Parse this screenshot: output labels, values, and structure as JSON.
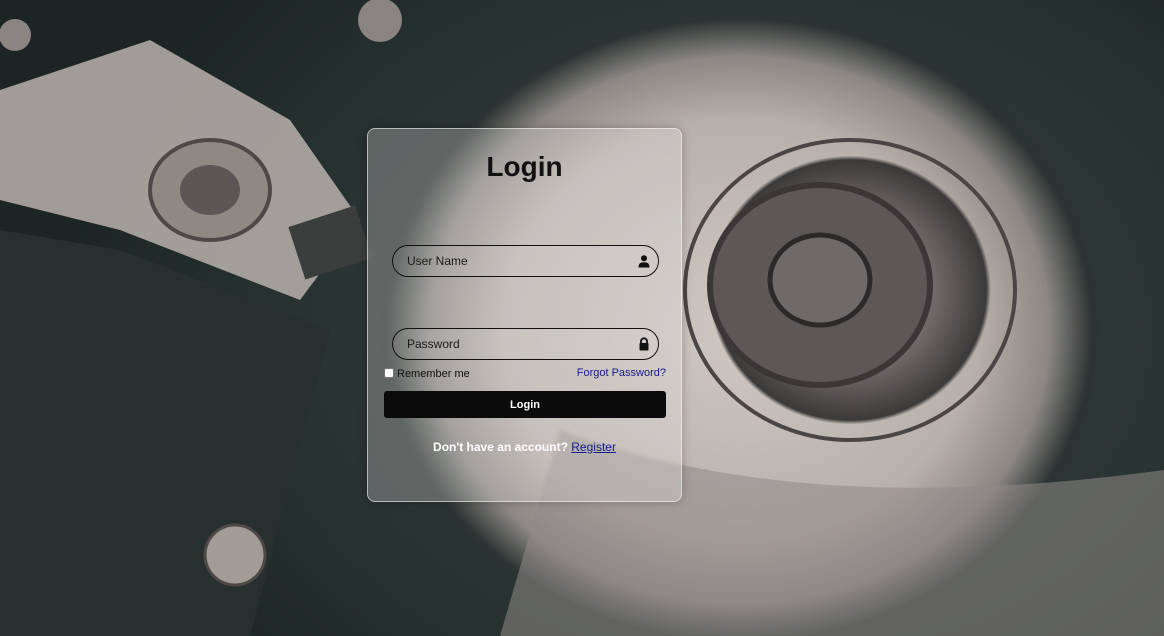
{
  "login": {
    "title": "Login",
    "username": {
      "placeholder": "User Name",
      "icon": "user-icon"
    },
    "password": {
      "placeholder": "Password",
      "icon": "lock-icon"
    },
    "remember_label": "Remember me",
    "forgot_label": "Forgot Password?",
    "button_label": "Login",
    "register_prompt": "Don't have an account?",
    "register_label": "Register"
  },
  "colors": {
    "button_bg": "#0b0b0b",
    "link": "#1a1a8c",
    "card_border": "#ffffff"
  }
}
